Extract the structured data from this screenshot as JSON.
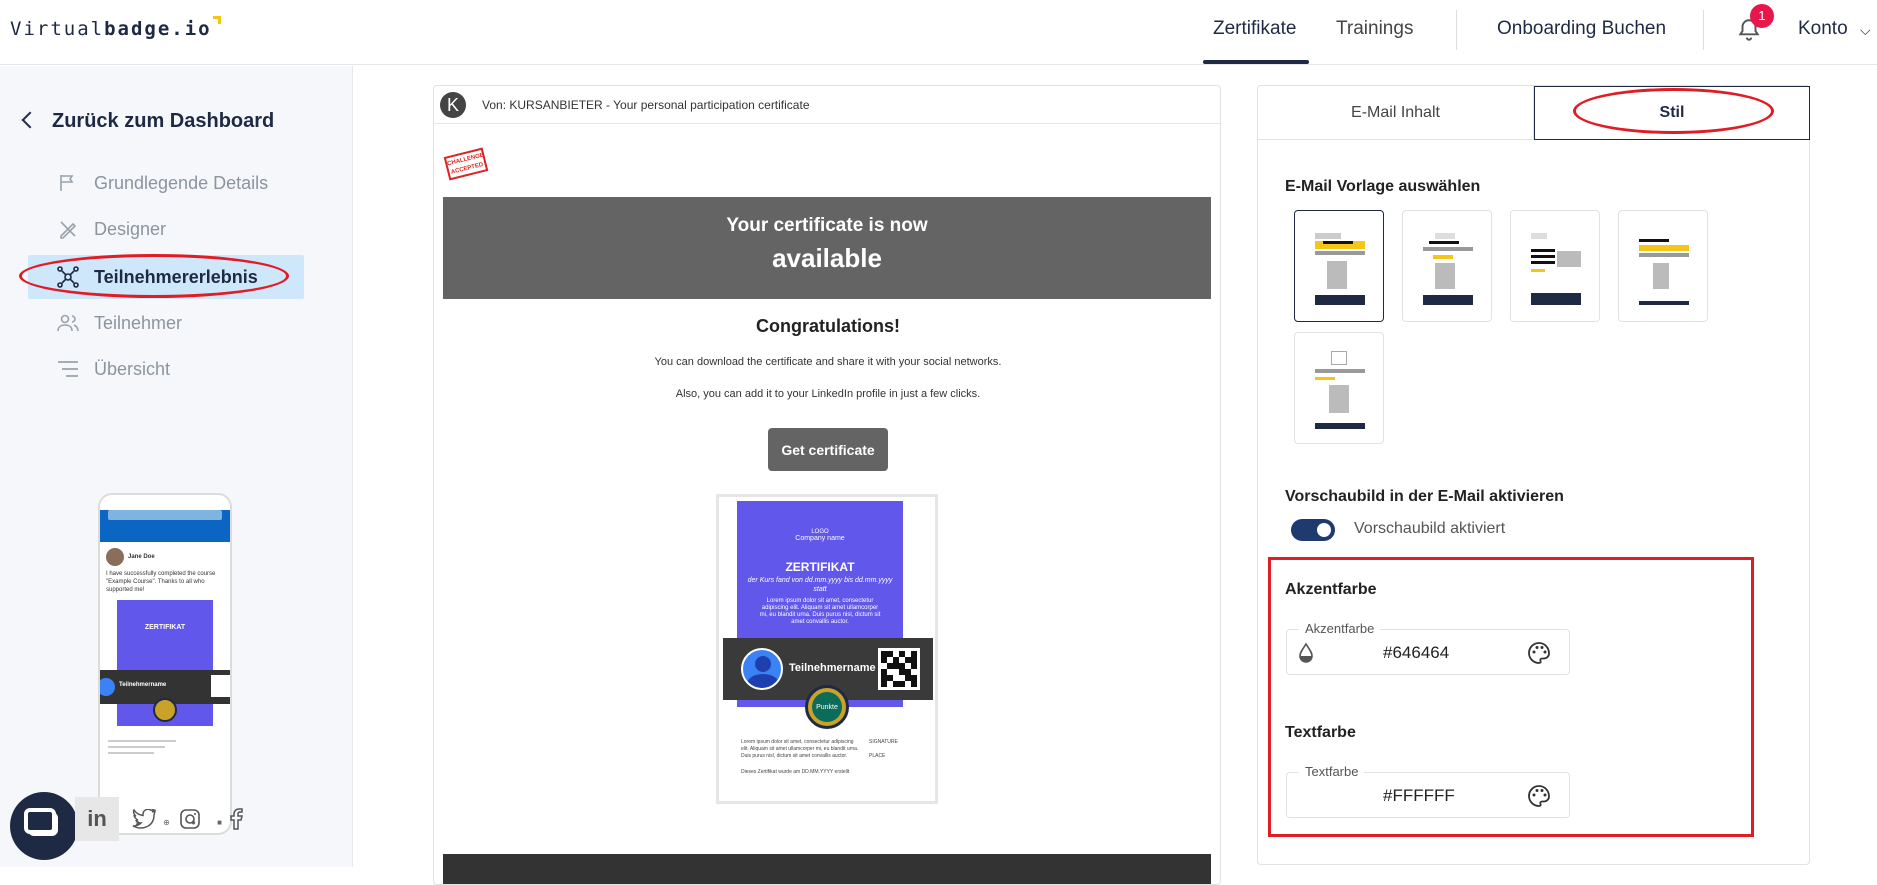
{
  "header": {
    "logo_light": "Virtual",
    "logo_bold": "badge.io",
    "nav": [
      "Zertifikate",
      "Trainings",
      "Onboarding Buchen"
    ],
    "notification_count": "1",
    "account": "Konto"
  },
  "sidebar": {
    "back_label": "Zurück zum Dashboard",
    "items": [
      {
        "label": "Grundlegende Details",
        "icon": "flag-icon"
      },
      {
        "label": "Designer",
        "icon": "pencil-ruler-icon"
      },
      {
        "label": "Teilnehmererlebnis",
        "icon": "network-icon",
        "active": true
      },
      {
        "label": "Teilnehmer",
        "icon": "users-icon"
      },
      {
        "label": "Übersicht",
        "icon": "list-icon"
      }
    ],
    "phone_preview": {
      "user_name": "Jane Doe",
      "post_text": "I have successfully completed the course \"Example Course\". Thanks to all who supported me!",
      "cert_title": "ZERTIFIKAT",
      "participant": "Teilnehmername"
    },
    "social": [
      "linkedin-icon",
      "twitter-icon",
      "instagram-icon",
      "facebook-icon"
    ]
  },
  "email": {
    "from": "Von: KURSANBIETER - Your personal participation certificate",
    "sender_initial": "K",
    "stamp": "CHALLENGE ACCEPTED",
    "banner_line1": "Your certificate is now",
    "banner_line2": "available",
    "congrats": "Congratulations!",
    "line1": "You can download the certificate and share it with your social networks.",
    "line2": "Also, you can add it to your LinkedIn profile in just a few clicks.",
    "button": "Get certificate",
    "certificate": {
      "logo": "LOGO",
      "company": "Company name",
      "title": "ZERTIFIKAT",
      "subtitle": "der Kurs fand von dd.mm.yyyy bis dd.mm.yyyy statt",
      "lorem": "Lorem ipsum dolor sit amet, consectetur adipiscing elit. Aliquam sit amet ullamcorper mi, eu blandit urna. Duis purus nisl, dictum sit amet convallis auctor.",
      "participant": "Teilnehmername",
      "medal": "Punkte",
      "foot_left": "Lorem ipsum dolor sit amet, consectetur adipiscing elit. Aliquam sit amet ullamcorper mi, eu blandit urna. Duis purus nisl, dictum sit amet convallis auctor.",
      "foot_date": "Dieses Zertifikat wurde am DD.MM.YYYY erstellt",
      "signature": "SIGNATURE",
      "place": "PLACE"
    }
  },
  "panel": {
    "tabs": [
      "E-Mail Inhalt",
      "Stil"
    ],
    "template_title": "E-Mail Vorlage auswählen",
    "preview_title": "Vorschaubild in der E-Mail aktivieren",
    "preview_toggle_label": "Vorschaubild aktiviert",
    "preview_enabled": true,
    "accent_title": "Akzentfarbe",
    "accent_label": "Akzentfarbe",
    "accent_value": "#646464",
    "text_title": "Textfarbe",
    "text_label": "Textfarbe",
    "text_value": "#FFFFFF"
  },
  "colors": {
    "accent": "#646464",
    "brand_navy": "#1e2a44",
    "cert_purple": "#6157ea",
    "annotation_red": "#e01c24",
    "template_yellow": "#f5c518"
  }
}
